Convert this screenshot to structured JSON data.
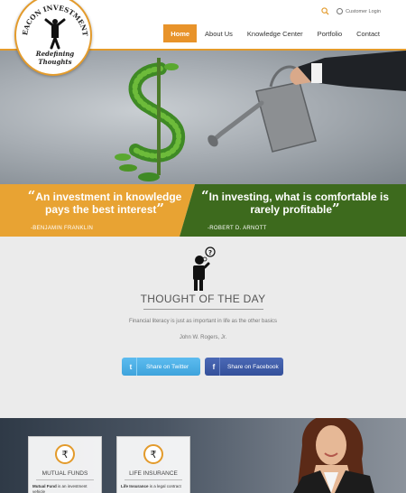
{
  "header": {
    "logo_title": "BEACON INVESTMENTS",
    "logo_tagline": "Redefining Thoughts",
    "login_label": "Customer Login",
    "nav": [
      {
        "label": "Home",
        "active": true
      },
      {
        "label": "About Us",
        "active": false
      },
      {
        "label": "Knowledge Center",
        "active": false
      },
      {
        "label": "Portfolio",
        "active": false
      },
      {
        "label": "Contact",
        "active": false
      }
    ]
  },
  "quotes": [
    {
      "text": "An investment in knowledge pays the best interest",
      "author": "-BENJAMIN FRANKLIN",
      "color": "#e8a333"
    },
    {
      "text": "In investing, what is comfortable is rarely profitable",
      "author": "-ROBERT D. ARNOTT",
      "color": "#3d6a1d"
    }
  ],
  "thought": {
    "title": "THOUGHT OF THE DAY",
    "text": "Financial literacy is just as important in life as the other basics",
    "author": "John W. Rogers, Jr.",
    "twitter_label": "Share on Twitter",
    "facebook_label": "Share on Facebook"
  },
  "cards": [
    {
      "title": "MUTUAL FUNDS",
      "lead": "Mutual Fund",
      "text": " is an investment vehicle"
    },
    {
      "title": "LIFE INSURANCE",
      "lead": "Life Insurance",
      "text": " is a legal contract"
    }
  ],
  "colors": {
    "accent": "#e8932a",
    "twitter": "#4fb0e8",
    "facebook": "#3b59a8"
  }
}
